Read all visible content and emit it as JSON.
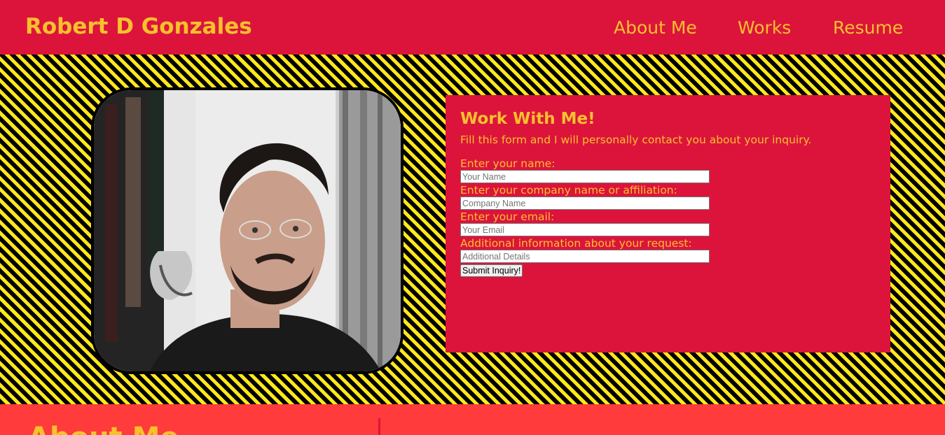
{
  "header": {
    "brand": "Robert D Gonzales",
    "nav": [
      {
        "label": "About Me"
      },
      {
        "label": "Works"
      },
      {
        "label": "Resume"
      }
    ]
  },
  "contact_panel": {
    "title": "Work With Me!",
    "intro": "Fill this form and I will personally contact you about your inquiry.",
    "fields": [
      {
        "label": "Enter your name:",
        "placeholder": "Your Name",
        "value": ""
      },
      {
        "label": "Enter your company name or affiliation:",
        "placeholder": "Company Name",
        "value": ""
      },
      {
        "label": "Enter your email:",
        "placeholder": "Your Email",
        "value": ""
      },
      {
        "label": "Additional information about your request:",
        "placeholder": "Additional Details",
        "value": ""
      }
    ],
    "submit_label": "Submit Inquiry!"
  },
  "about": {
    "title": "About Me"
  },
  "colors": {
    "header_bg": "#dc143c",
    "accent_text": "#f7c12c",
    "stripe_dark": "#000000",
    "stripe_light": "#ffe81c",
    "about_bg": "#ff3b3b"
  },
  "icons": {
    "profile_photo": "profile-photo-icon"
  }
}
